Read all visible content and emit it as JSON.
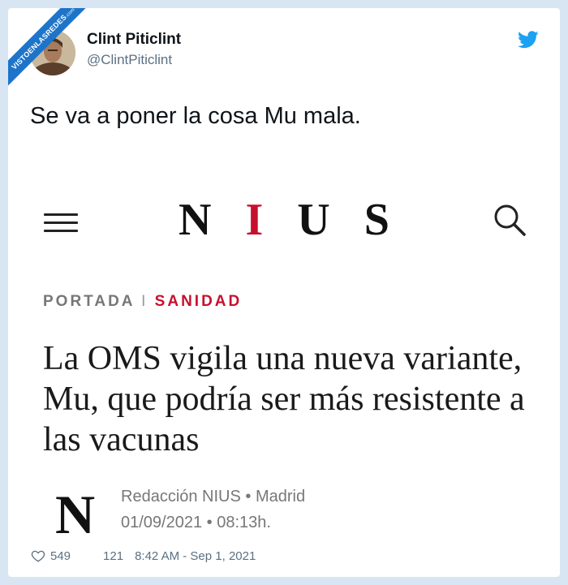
{
  "watermark": {
    "text": "VISTOENLASREDES",
    "sub": ".com"
  },
  "user": {
    "name": "Clint Piticlint",
    "handle": "@ClintPiticlint"
  },
  "tweet": {
    "text": "Se va a poner la cosa Mu mala."
  },
  "article": {
    "logo": {
      "letters": [
        "N",
        "I",
        "U",
        "S"
      ]
    },
    "breadcrumb": {
      "section": "PORTADA",
      "separator": "I",
      "category": "SANIDAD"
    },
    "headline": "La OMS vigila una nueva variante, Mu, que podría ser más resistente a las vacunas",
    "author_logo": "N",
    "author": "Redacción NIUS",
    "location": "Madrid",
    "date": "01/09/2021",
    "time": "08:13h.",
    "dot": "•"
  },
  "footer": {
    "likes": "549",
    "retweets": "121",
    "timestamp": "8:42 AM - Sep 1, 2021"
  },
  "colors": {
    "accent": "#c8102e",
    "twitter": "#1da1f2",
    "watermark": "#1d74c9"
  },
  "icons": {
    "bird": "twitter-bird-icon",
    "menu": "hamburger-menu-icon",
    "search": "search-icon",
    "like": "heart-icon"
  }
}
